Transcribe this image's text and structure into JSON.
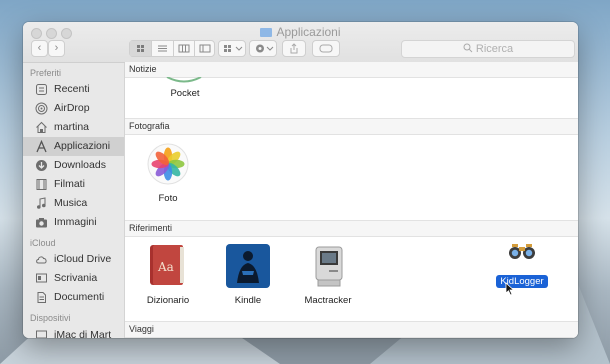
{
  "window": {
    "title": "Applicazioni"
  },
  "toolbar": {
    "back": "‹",
    "forward": "›",
    "search_placeholder": "Ricerca"
  },
  "sidebar": {
    "sections": [
      {
        "header": "Preferiti",
        "items": [
          {
            "label": "Recenti",
            "icon": "clock-icon"
          },
          {
            "label": "AirDrop",
            "icon": "airdrop-icon"
          },
          {
            "label": "martina",
            "icon": "home-icon"
          },
          {
            "label": "Applicazioni",
            "icon": "applications-icon",
            "selected": true
          },
          {
            "label": "Downloads",
            "icon": "download-icon"
          },
          {
            "label": "Filmati",
            "icon": "film-icon"
          },
          {
            "label": "Musica",
            "icon": "music-icon"
          },
          {
            "label": "Immagini",
            "icon": "camera-icon"
          }
        ]
      },
      {
        "header": "iCloud",
        "items": [
          {
            "label": "iCloud Drive",
            "icon": "cloud-icon"
          },
          {
            "label": "Scrivania",
            "icon": "desktop-icon"
          },
          {
            "label": "Documenti",
            "icon": "document-icon"
          }
        ]
      },
      {
        "header": "Dispositivi",
        "items": [
          {
            "label": "iMac di Mart",
            "icon": "computer-icon"
          }
        ]
      }
    ]
  },
  "content": {
    "sections": [
      {
        "header": "Notizie",
        "apps": [
          {
            "label": "Pocket"
          }
        ]
      },
      {
        "header": "Fotografia",
        "apps": [
          {
            "label": "Foto"
          }
        ]
      },
      {
        "header": "Riferimenti",
        "apps": [
          {
            "label": "Dizionario"
          },
          {
            "label": "Kindle"
          },
          {
            "label": "Mactracker"
          },
          {
            "label": "KidLogger",
            "selected": true
          }
        ]
      },
      {
        "header": "Viaggi",
        "apps": []
      }
    ]
  },
  "colors": {
    "selection_blue": "#1a62d6",
    "sidebar_bg": "#e8e8e8"
  }
}
